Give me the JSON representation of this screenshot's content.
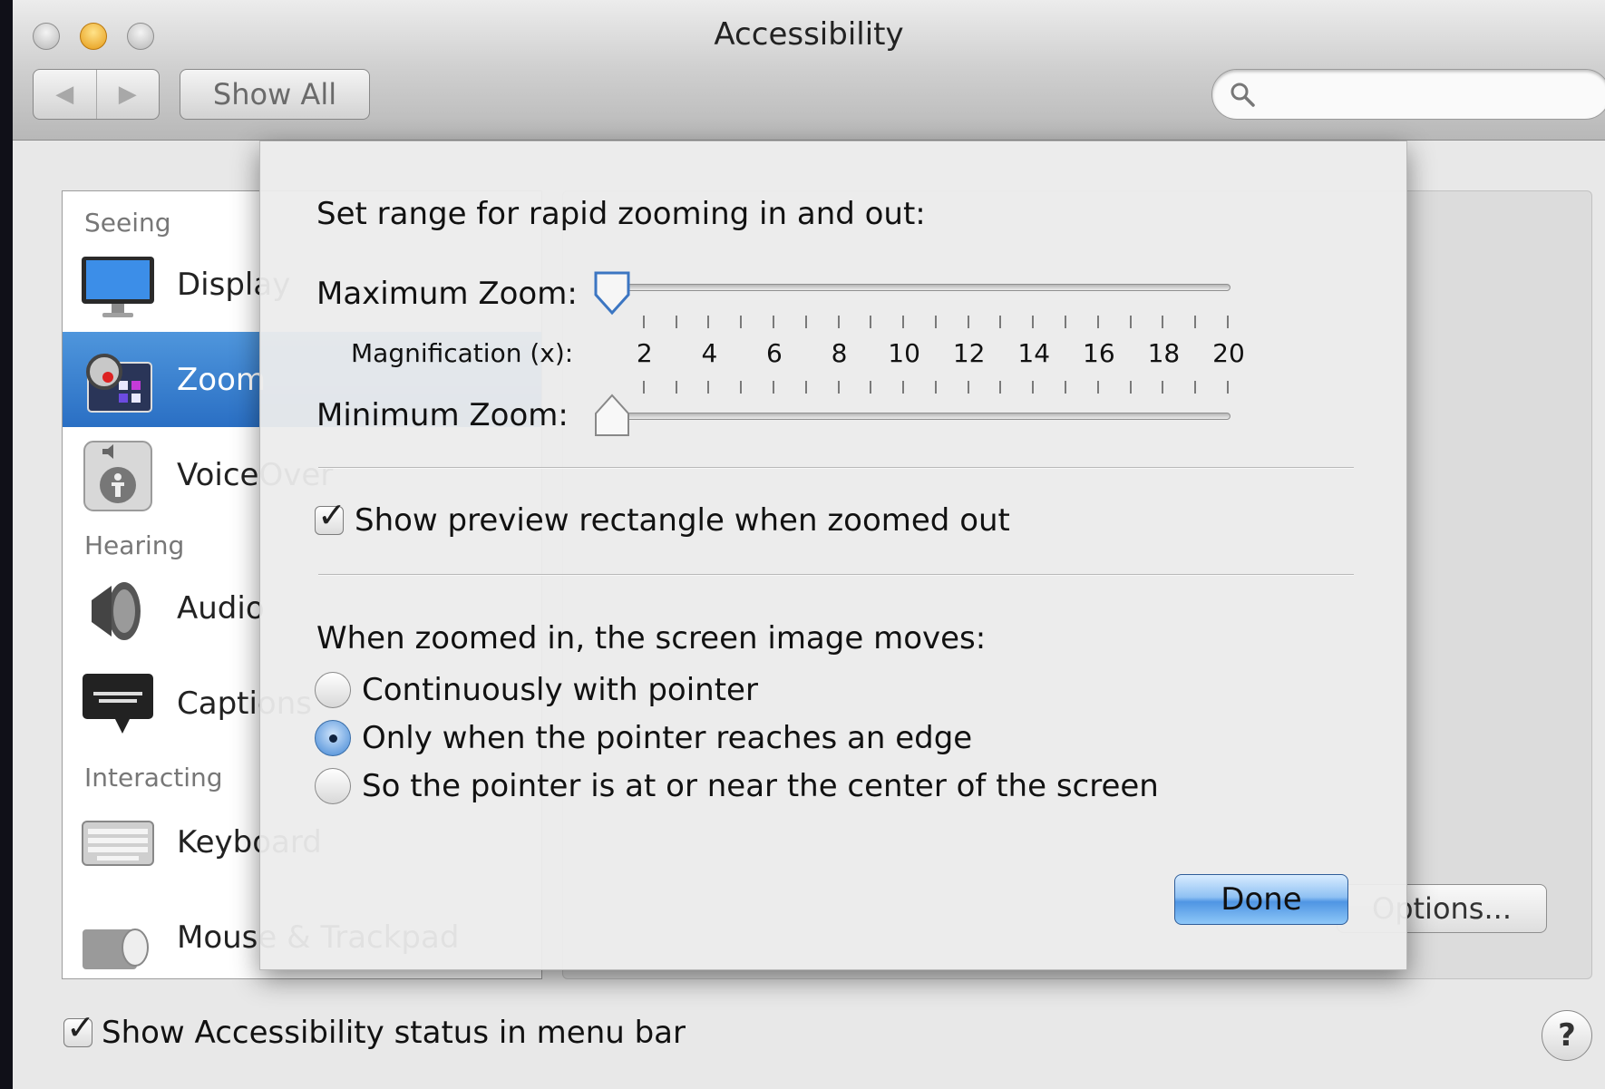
{
  "window": {
    "title": "Accessibility"
  },
  "toolbar": {
    "show_all_label": "Show All",
    "back_icon": "◀",
    "forward_icon": "▶",
    "search_placeholder": ""
  },
  "sidebar": {
    "sections": [
      "Seeing",
      "Hearing",
      "Interacting"
    ],
    "items": [
      {
        "label": "Display",
        "icon": "display-icon"
      },
      {
        "label": "Zoom",
        "icon": "zoom-icon",
        "selected": true
      },
      {
        "label": "VoiceOver",
        "icon": "voiceover-icon"
      },
      {
        "label": "Audio",
        "icon": "speaker-icon"
      },
      {
        "label": "Captions",
        "icon": "captions-icon"
      },
      {
        "label": "Keyboard",
        "icon": "keyboard-icon"
      },
      {
        "label": "Mouse & Trackpad",
        "icon": "mouse-icon"
      }
    ]
  },
  "main": {
    "options_label": "Options...",
    "status_checkbox_label": "Show Accessibility status in menu bar",
    "status_checked": true,
    "help_label": "?"
  },
  "sheet": {
    "title": "Set range for rapid zooming in and out:",
    "max_zoom_label": "Maximum Zoom:",
    "min_zoom_label": "Minimum Zoom:",
    "magnification_label": "Magnification (x):",
    "tick_labels": [
      "2",
      "4",
      "6",
      "8",
      "10",
      "12",
      "14",
      "16",
      "18",
      "20"
    ],
    "max_zoom_value": 1,
    "min_zoom_value": 1,
    "preview_checkbox_label": "Show preview rectangle when zoomed out",
    "preview_checked": true,
    "moves_heading": "When zoomed in, the screen image moves:",
    "radio_options": [
      "Continuously with pointer",
      "Only when the pointer reaches an edge",
      "So the pointer is at or near the center of the screen"
    ],
    "selected_radio": 1,
    "done_label": "Done"
  },
  "colors": {
    "selection": "#2a6fc4",
    "done_button": "#4f95e3"
  }
}
